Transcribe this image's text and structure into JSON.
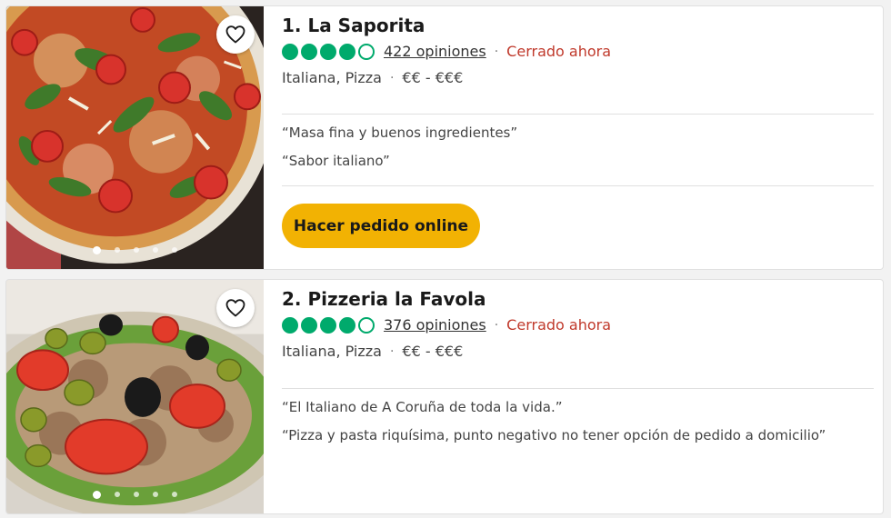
{
  "colors": {
    "rating_green": "#00aa6c",
    "closed_red": "#c0392b",
    "order_yellow": "#f2b203"
  },
  "restaurants": [
    {
      "title": "1. La Saporita",
      "rating": 4,
      "rating_max": 5,
      "reviews": "422 opiniones",
      "status": "Cerrado ahora",
      "cuisine": "Italiana, Pizza",
      "price": "€€ - €€€",
      "quotes": [
        "“Masa fina y buenos ingredientes”",
        "“Sabor italiano”"
      ],
      "order_label": "Hacer pedido online",
      "photo": "pizza-photo",
      "photo_count": 5,
      "active_photo": 1
    },
    {
      "title": "2. Pizzeria la Favola",
      "rating": 4,
      "rating_max": 5,
      "reviews": "376 opiniones",
      "status": "Cerrado ahora",
      "cuisine": "Italiana, Pizza",
      "price": "€€ - €€€",
      "quotes": [
        "“El Italiano de A Coruña de toda la vida.”",
        "“Pizza y pasta riquísima, punto negativo no tener opción de pedido a domicilio”"
      ],
      "photo": "salad-photo",
      "photo_count": 5,
      "active_photo": 1
    }
  ],
  "separator": "·",
  "icons": {
    "save": "heart-icon"
  }
}
